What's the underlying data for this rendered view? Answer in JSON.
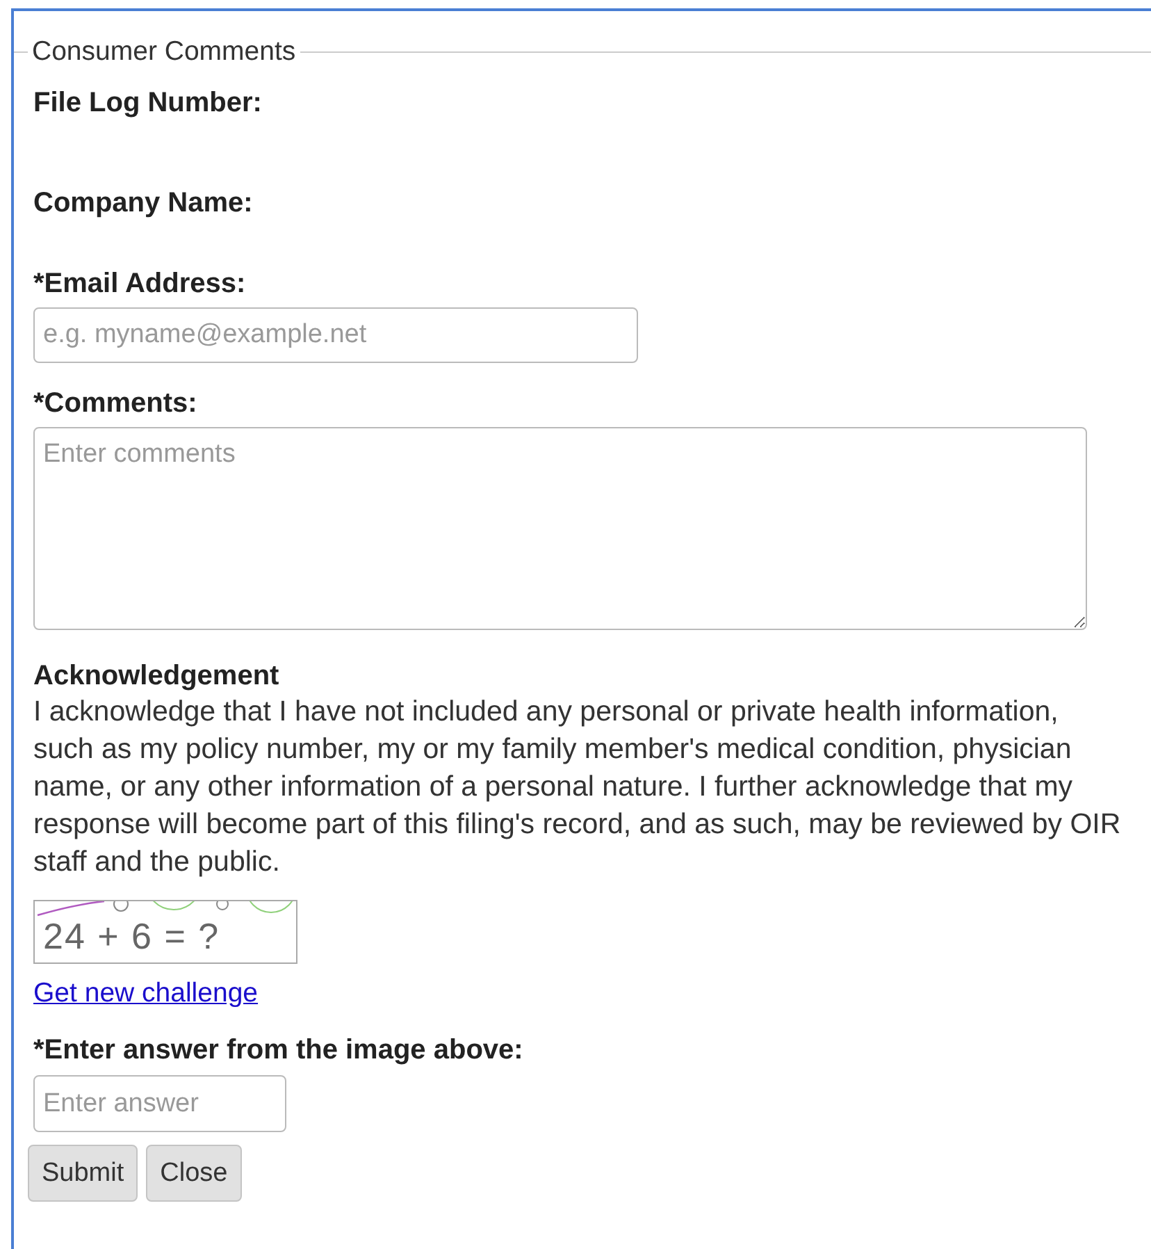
{
  "legend": "Consumer Comments",
  "info_fields": [
    {
      "label": "File Log Number:"
    },
    {
      "label": "Company Name:"
    }
  ],
  "email": {
    "label": "*Email Address:",
    "placeholder": "e.g. myname@example.net"
  },
  "comments": {
    "label": "*Comments:",
    "placeholder": "Enter comments"
  },
  "acknowledgement": {
    "title": "Acknowledgement",
    "text": "I acknowledge that I have not included any personal or private health information, such as my policy number, my or my family member's medical condition, physician name, or any other information of a personal nature. I further acknowledge that my response will become part of this filing's record, and as such, may be reviewed by OIR staff and the public."
  },
  "captcha": {
    "challenge": "24 + 6 = ?",
    "new_challenge_link": "Get new challenge",
    "label": "*Enter answer from the image above:",
    "placeholder": "Enter answer"
  },
  "buttons": [
    "Submit",
    "Close"
  ]
}
